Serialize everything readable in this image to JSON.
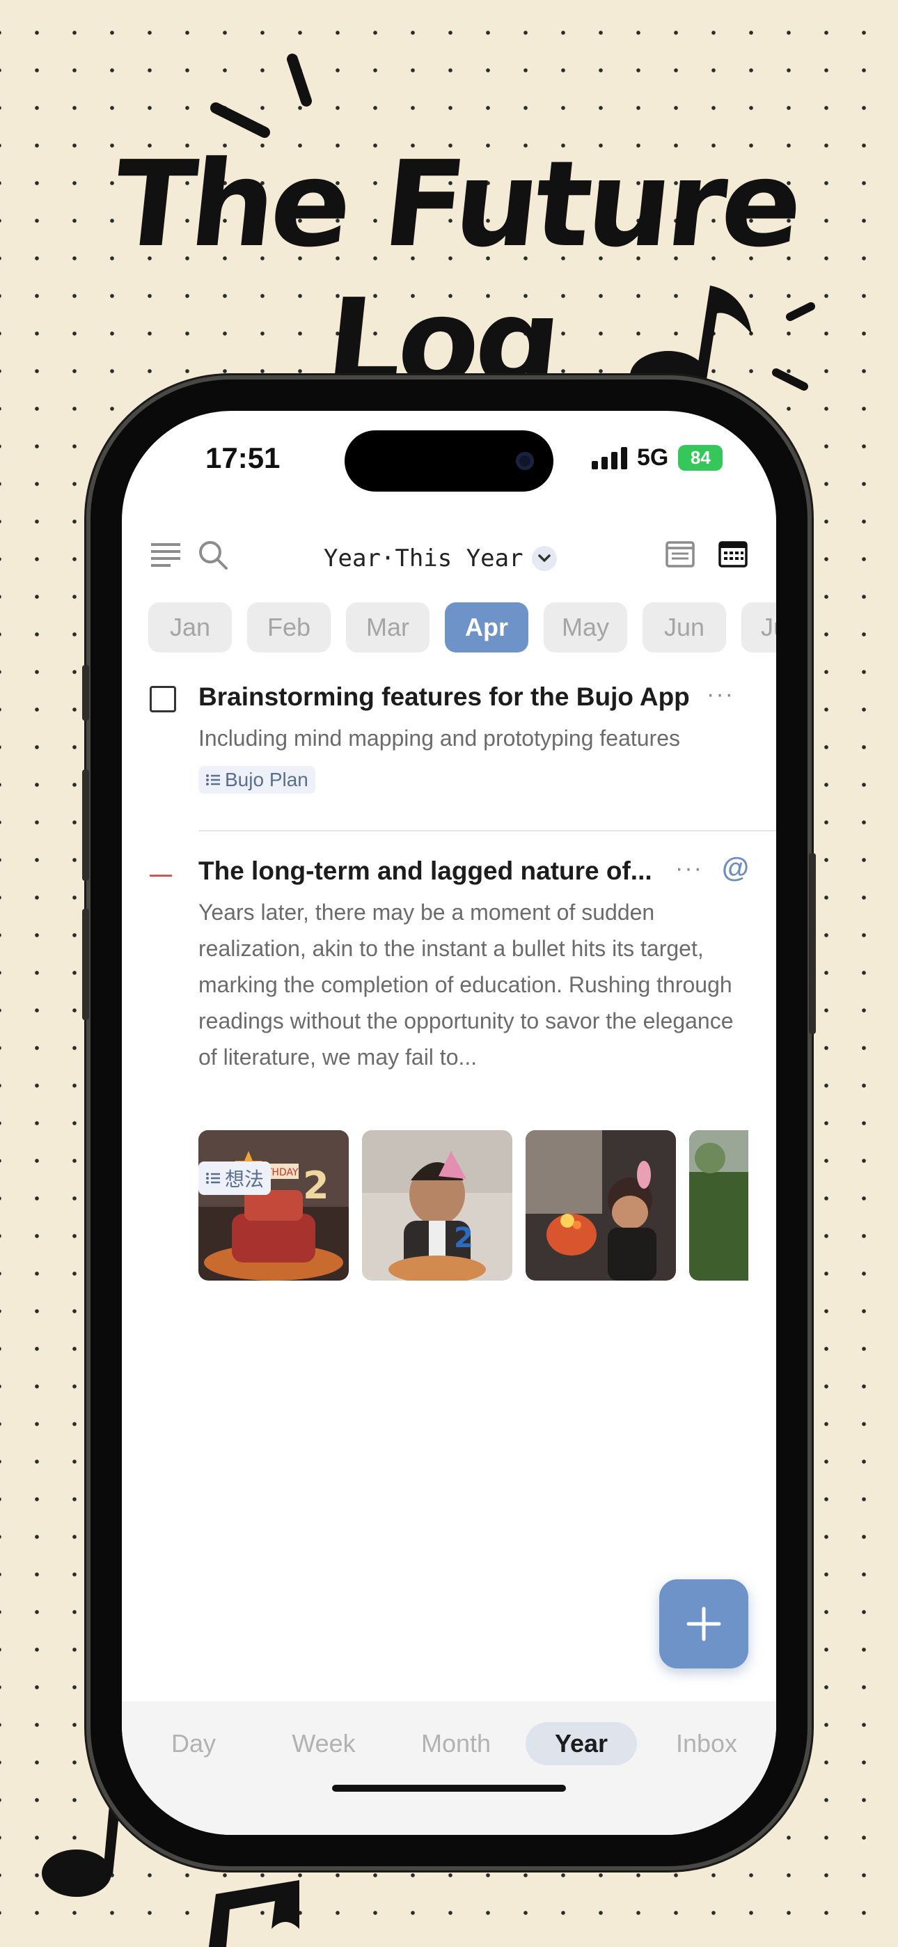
{
  "headline": "The Future Log",
  "status_bar": {
    "time": "17:51",
    "network": "5G",
    "battery": "84"
  },
  "toolbar": {
    "view_label": "Year·This Year"
  },
  "months": [
    "Jan",
    "Feb",
    "Mar",
    "Apr",
    "May",
    "Jun",
    "Jul"
  ],
  "active_month": "Apr",
  "entries": [
    {
      "title": "Brainstorming features for the Bujo App",
      "body": "Including mind mapping and prototyping features",
      "tag": "Bujo Plan",
      "more": "···"
    },
    {
      "title": "The long-term and lagged nature of...",
      "body": "Years later, there may be a moment of sudden realization, akin to the instant a bullet hits its target, marking the completion of education. Rushing through readings without the opportunity to savor the elegance of literature, we may fail to...",
      "tag": "想法",
      "more": "···",
      "mention": "@"
    }
  ],
  "tabs": [
    "Day",
    "Week",
    "Month",
    "Year",
    "Inbox"
  ],
  "active_tab": "Year",
  "colors": {
    "accent": "#6e93c8",
    "background": "#f3ebd6",
    "migrated_dash": "#d9534f",
    "battery": "#35c759"
  }
}
